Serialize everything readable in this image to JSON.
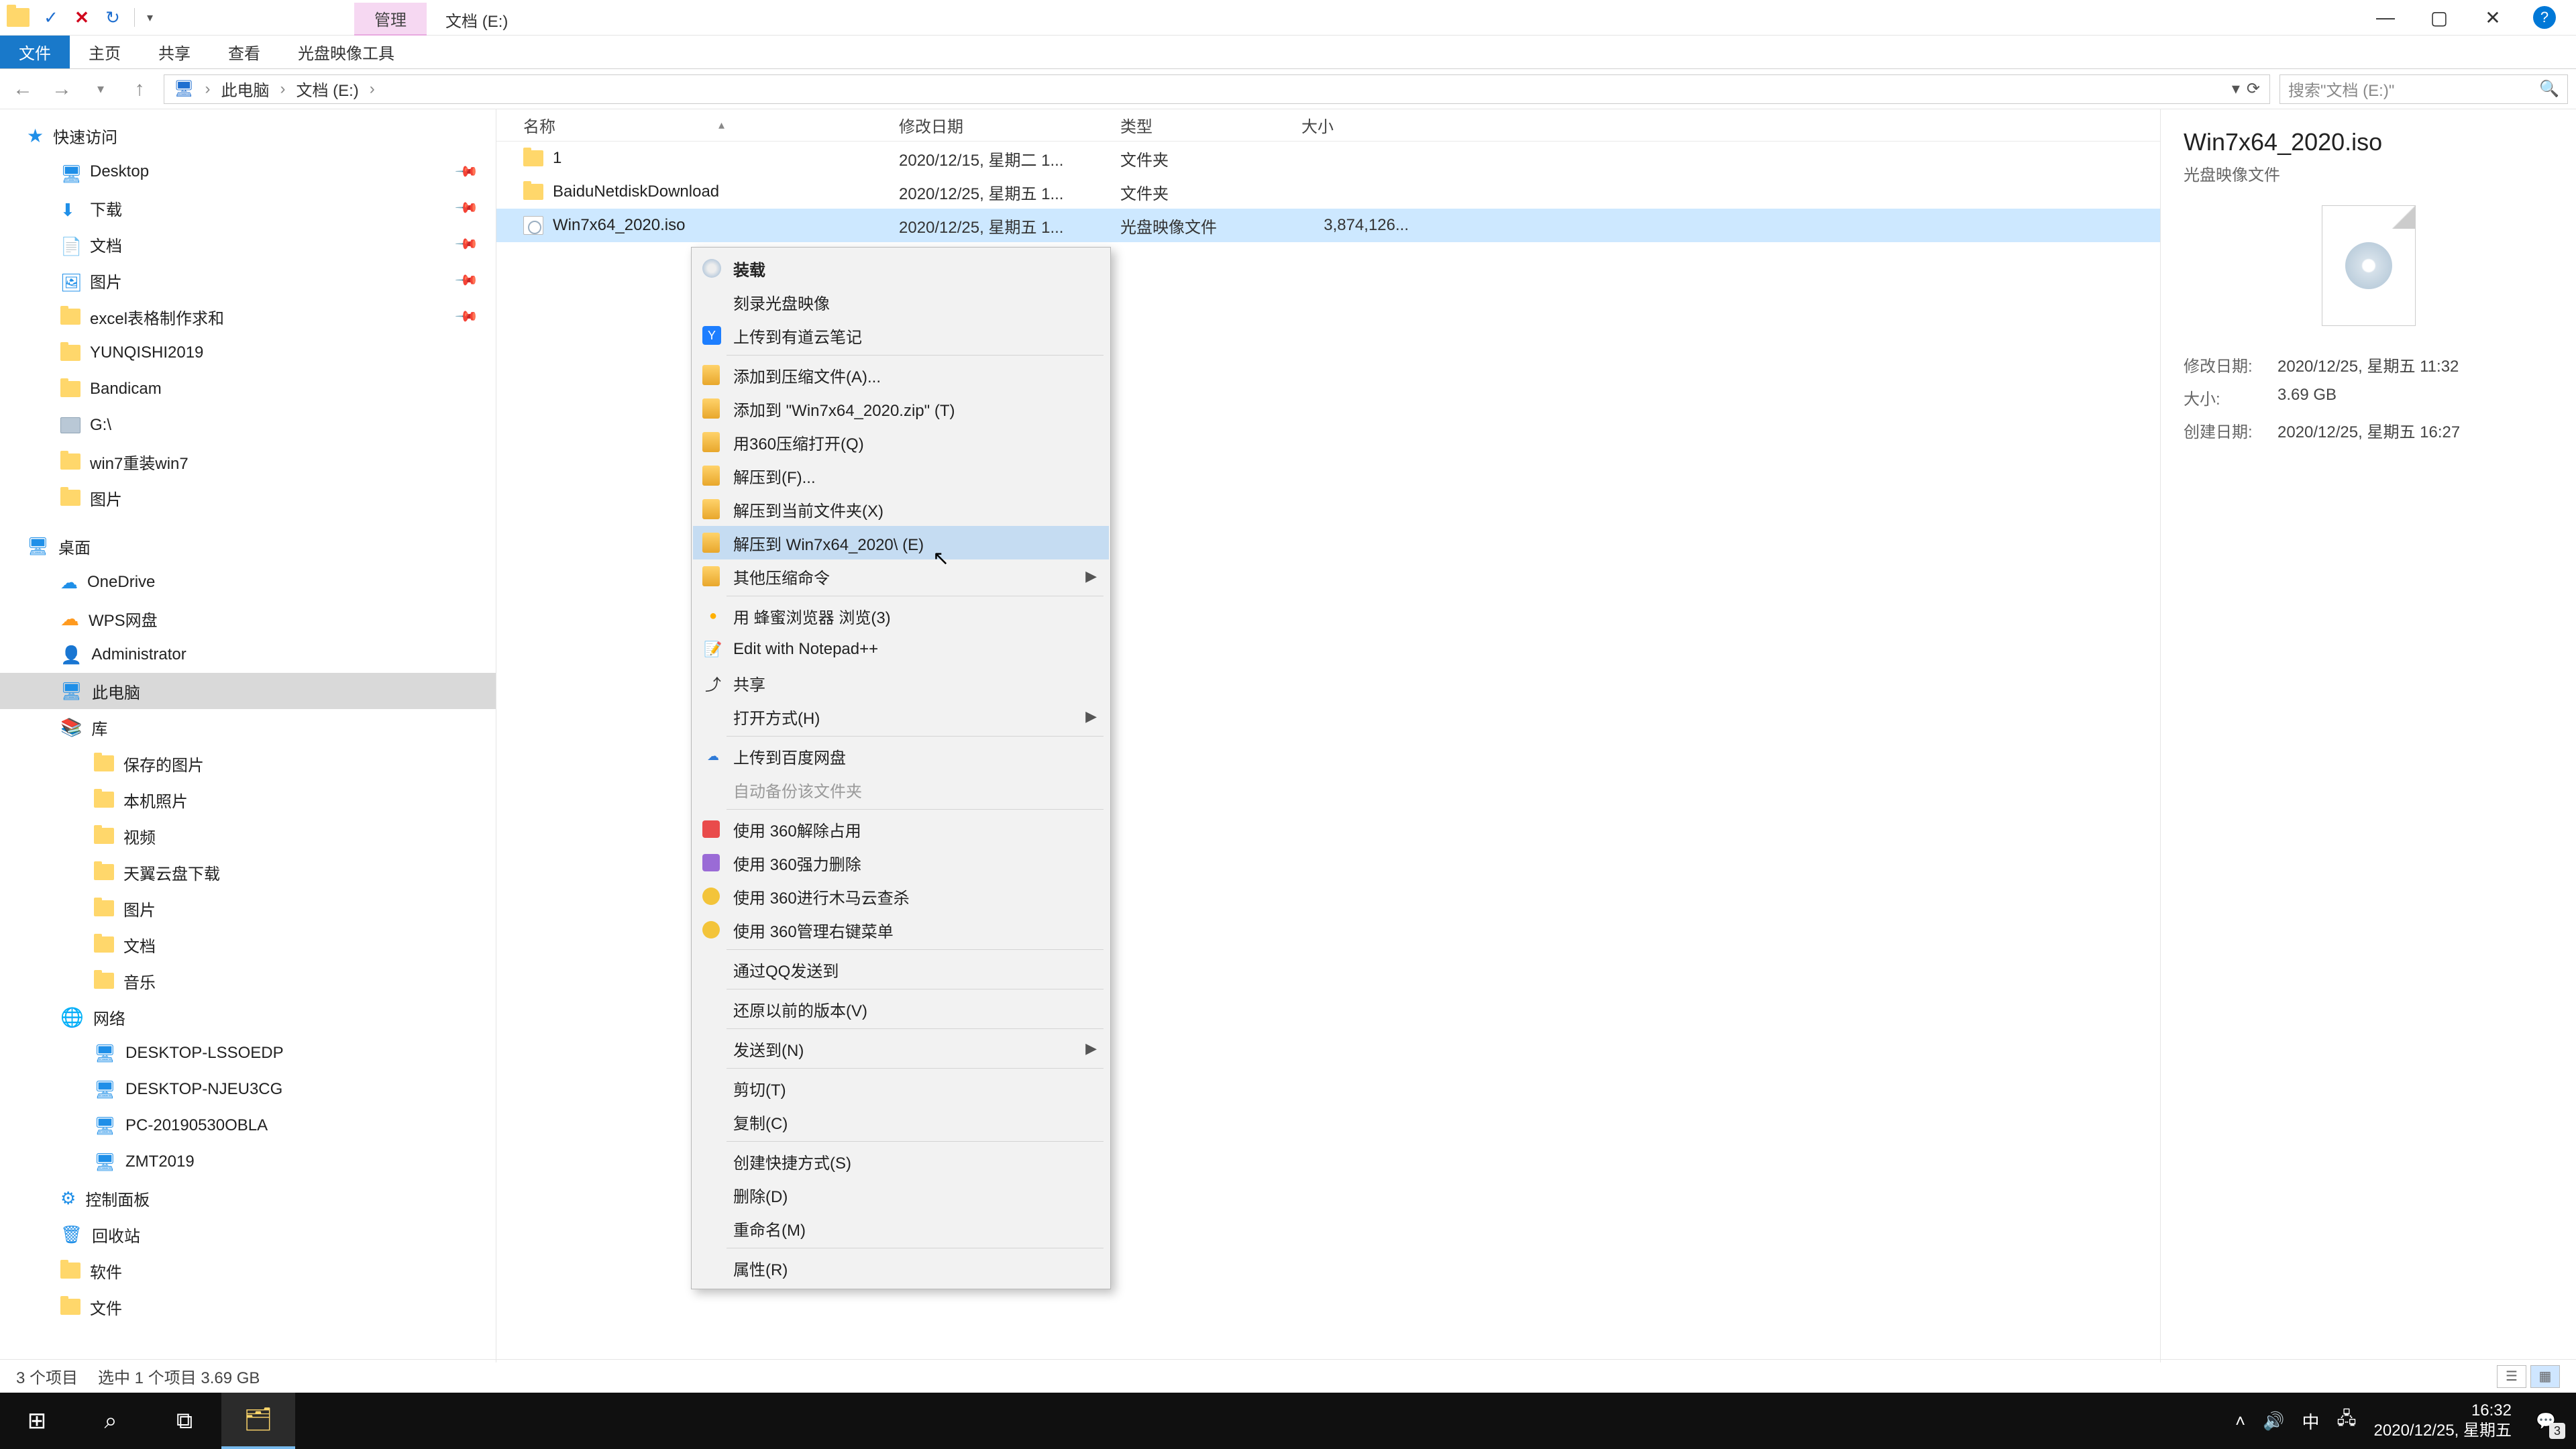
{
  "titlebar": {
    "manage_tab": "管理",
    "context_tab": "文档 (E:)"
  },
  "ribbon": {
    "file": "文件",
    "home": "主页",
    "share": "共享",
    "view": "查看",
    "disc_tools": "光盘映像工具"
  },
  "address": {
    "root": "此电脑",
    "drive": "文档 (E:)"
  },
  "search": {
    "placeholder": "搜索\"文档 (E:)\""
  },
  "tree": {
    "quick": "快速访问",
    "desktop": "Desktop",
    "downloads": "下载",
    "documents": "文档",
    "pictures": "图片",
    "excel": "excel表格制作求和",
    "yunqishi": "YUNQISHI2019",
    "bandicam": "Bandicam",
    "gdrive": "G:\\",
    "win7reinstall": "win7重装win7",
    "pictures2": "图片",
    "desktop_zh": "桌面",
    "onedrive": "OneDrive",
    "wps": "WPS网盘",
    "admin": "Administrator",
    "thispc": "此电脑",
    "library": "库",
    "saved_pics": "保存的图片",
    "local_photos": "本机照片",
    "videos": "视频",
    "tianyi": "天翼云盘下载",
    "pics_lib": "图片",
    "docs_lib": "文档",
    "music_lib": "音乐",
    "network": "网络",
    "pc1": "DESKTOP-LSSOEDP",
    "pc2": "DESKTOP-NJEU3CG",
    "pc3": "PC-20190530OBLA",
    "pc4": "ZMT2019",
    "control": "控制面板",
    "recycle": "回收站",
    "software": "软件",
    "files": "文件"
  },
  "columns": {
    "name": "名称",
    "modified": "修改日期",
    "type": "类型",
    "size": "大小"
  },
  "files": {
    "rows": [
      {
        "name": "1",
        "modified": "2020/12/15, 星期二 1...",
        "type": "文件夹",
        "size": "",
        "icon": "folder"
      },
      {
        "name": "BaiduNetdiskDownload",
        "modified": "2020/12/25, 星期五 1...",
        "type": "文件夹",
        "size": "",
        "icon": "folder"
      },
      {
        "name": "Win7x64_2020.iso",
        "modified": "2020/12/25, 星期五 1...",
        "type": "光盘映像文件",
        "size": "3,874,126...",
        "icon": "iso",
        "selected": true
      }
    ]
  },
  "context_menu": {
    "mount": "装载",
    "burn": "刻录光盘映像",
    "ynote": "上传到有道云笔记",
    "add_archive": "添加到压缩文件(A)...",
    "add_zip": "添加到 \"Win7x64_2020.zip\" (T)",
    "open_360zip": "用360压缩打开(Q)",
    "extract_to": "解压到(F)...",
    "extract_here": "解压到当前文件夹(X)",
    "extract_named": "解压到 Win7x64_2020\\ (E)",
    "other_zip": "其他压缩命令",
    "honey": "用 蜂蜜浏览器 浏览(3)",
    "notepadpp": "Edit with Notepad++",
    "share": "共享",
    "open_with": "打开方式(H)",
    "baidu": "上传到百度网盘",
    "autobackup": "自动备份该文件夹",
    "rel360_unlock": "使用 360解除占用",
    "rel360_delete": "使用 360强力删除",
    "rel360_scan": "使用 360进行木马云查杀",
    "rel360_menu": "使用 360管理右键菜单",
    "qq_send": "通过QQ发送到",
    "restore": "还原以前的版本(V)",
    "send_to": "发送到(N)",
    "cut": "剪切(T)",
    "copy": "复制(C)",
    "shortcut": "创建快捷方式(S)",
    "delete": "删除(D)",
    "rename": "重命名(M)",
    "properties": "属性(R)"
  },
  "preview": {
    "title": "Win7x64_2020.iso",
    "subtitle": "光盘映像文件",
    "modified_k": "修改日期:",
    "modified_v": "2020/12/25, 星期五 11:32",
    "size_k": "大小:",
    "size_v": "3.69 GB",
    "created_k": "创建日期:",
    "created_v": "2020/12/25, 星期五 16:27"
  },
  "status": {
    "count": "3 个项目",
    "selection": "选中 1 个项目  3.69 GB"
  },
  "taskbar": {
    "ime": "中",
    "time": "16:32",
    "date": "2020/12/25, 星期五",
    "notif_count": "3"
  }
}
